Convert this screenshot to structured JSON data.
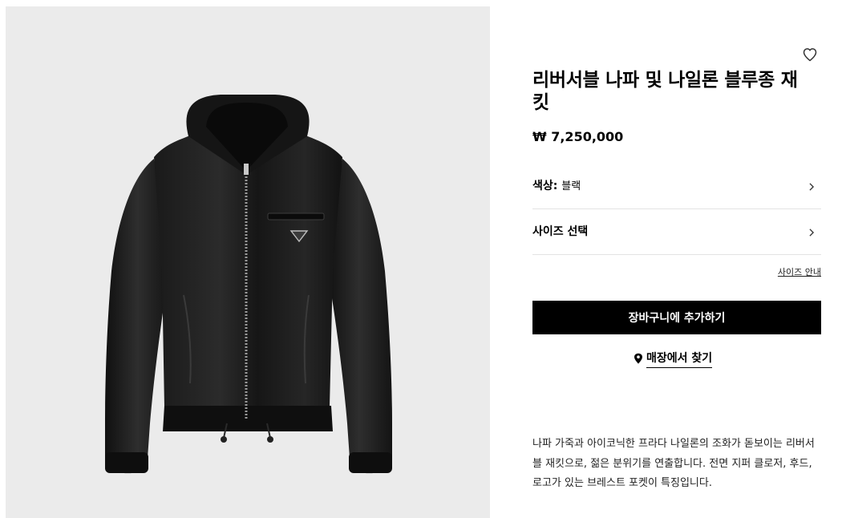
{
  "product": {
    "title": "리버서블 나파 및 나일론 블루종 재킷",
    "price": "₩ 7,250,000",
    "image_alt": "black leather hooded jacket"
  },
  "options": {
    "color_label": "색상:",
    "color_value": "블랙",
    "size_label": "사이즈 선택",
    "size_guide": "사이즈 안내"
  },
  "actions": {
    "add_to_cart": "장바구니에 추가하기",
    "find_in_store": "매장에서 찾기"
  },
  "description": "나파 가죽과 아이코닉한 프라다 나일론의 조화가 돋보이는 리버서블 재킷으로, 젊은 분위기를 연출합니다. 전면 지퍼 클로저, 후드, 로고가 있는 브레스트 포켓이 특징입니다.",
  "icons": {
    "wishlist": "heart-icon",
    "chevron": "chevron-right-icon",
    "pin": "location-pin-icon"
  },
  "colors": {
    "image_bg": "#ebebeb",
    "button_bg": "#000000",
    "divider": "#e3e3e3"
  }
}
